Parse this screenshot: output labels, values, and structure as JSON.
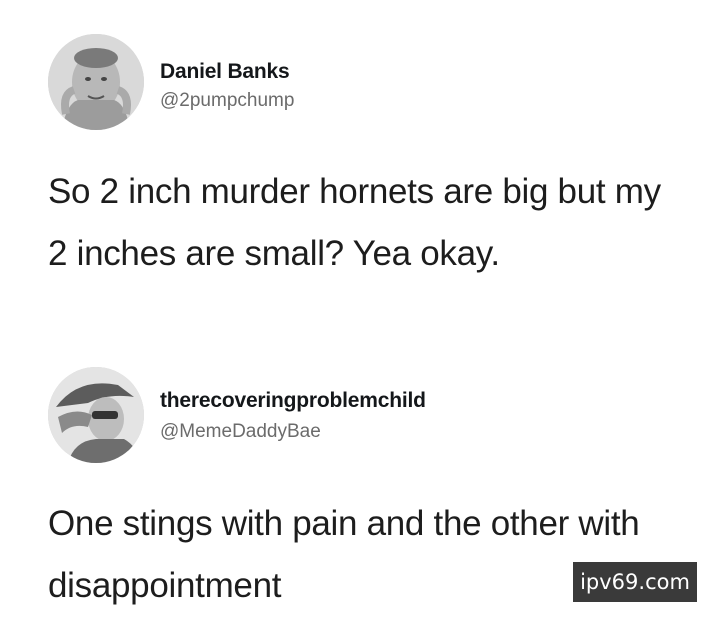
{
  "tweets": [
    {
      "user": {
        "display_name": "Daniel Banks",
        "handle": "@2pumpchump",
        "avatar_icon": "user-avatar-photo"
      },
      "text": "So 2 inch murder hornets are big but my 2 inches are small? Yea okay."
    },
    {
      "user": {
        "display_name": "therecoveringproblemchild",
        "handle": "@MemeDaddyBae",
        "avatar_icon": "user-avatar-photo"
      },
      "text": "One stings with pain and the other with disappointment"
    }
  ],
  "watermark": {
    "text": "ipv69.com",
    "background": "#3a3a3a"
  }
}
